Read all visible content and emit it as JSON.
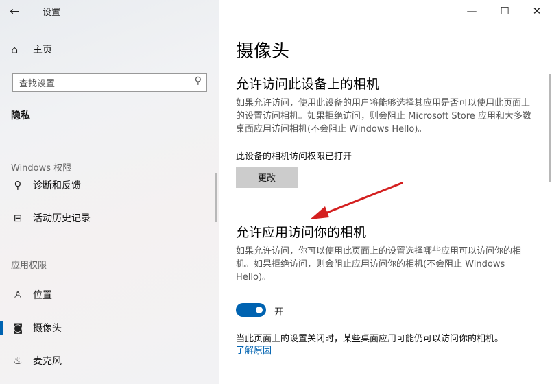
{
  "window": {
    "title": "设置",
    "back_icon": "←",
    "minimize_icon": "—",
    "maximize_icon": "☐",
    "close_icon": "✕"
  },
  "sidebar": {
    "home": {
      "icon": "⌂",
      "label": "主页"
    },
    "search": {
      "placeholder": "查找设置",
      "icon": "⚲"
    },
    "category": "隐私",
    "groups": [
      {
        "label": "Windows 权限",
        "items": [
          {
            "icon": "⚲",
            "label": "诊断和反馈"
          },
          {
            "icon": "⊟",
            "label": "活动历史记录"
          }
        ]
      },
      {
        "label": "应用权限",
        "items": [
          {
            "icon": "♙",
            "label": "位置"
          },
          {
            "icon": "◙",
            "label": "摄像头",
            "active": true
          },
          {
            "icon": "♨",
            "label": "麦克风"
          }
        ]
      }
    ]
  },
  "main": {
    "title": "摄像头",
    "device_section": {
      "heading": "允许访问此设备上的相机",
      "description": "如果允许访问，使用此设备的用户将能够选择其应用是否可以使用此页面上的设置访问相机。如果拒绝访问，则会阻止 Microsoft Store 应用和大多数桌面应用访问相机(不会阻止 Windows Hello)。",
      "status": "此设备的相机访问权限已打开",
      "change_button": "更改"
    },
    "apps_section": {
      "heading": "允许应用访问你的相机",
      "description": "如果允许访问，你可以使用此页面上的设置选择哪些应用可以访问你的相机。如果拒绝访问，则会阻止应用访问你的相机(不会阻止 Windows Hello)。",
      "toggle_state": "开",
      "toggle_on": true,
      "note": "当此页面上的设置关闭时，某些桌面应用可能仍可以访问你的相机。",
      "link": "了解原因"
    }
  },
  "colors": {
    "accent": "#0063b1",
    "annotation_arrow": "#d42020"
  }
}
